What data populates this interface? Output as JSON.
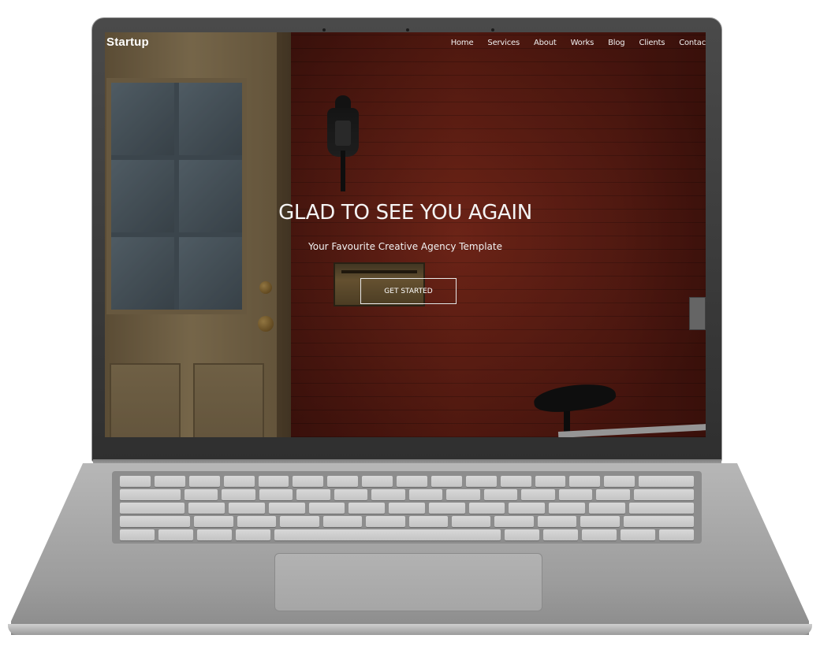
{
  "site": {
    "brand": "Startup",
    "nav": [
      "Home",
      "Services",
      "About",
      "Works",
      "Blog",
      "Clients",
      "Contac"
    ]
  },
  "hero": {
    "title": "GLAD TO SEE YOU AGAIN",
    "subtitle": "Your Favourite Creative Agency Template",
    "cta_label": "GET STARTED"
  },
  "colors": {
    "wall": "#7a2318",
    "text": "#ffffff",
    "device_body": "#a9a9a9"
  }
}
